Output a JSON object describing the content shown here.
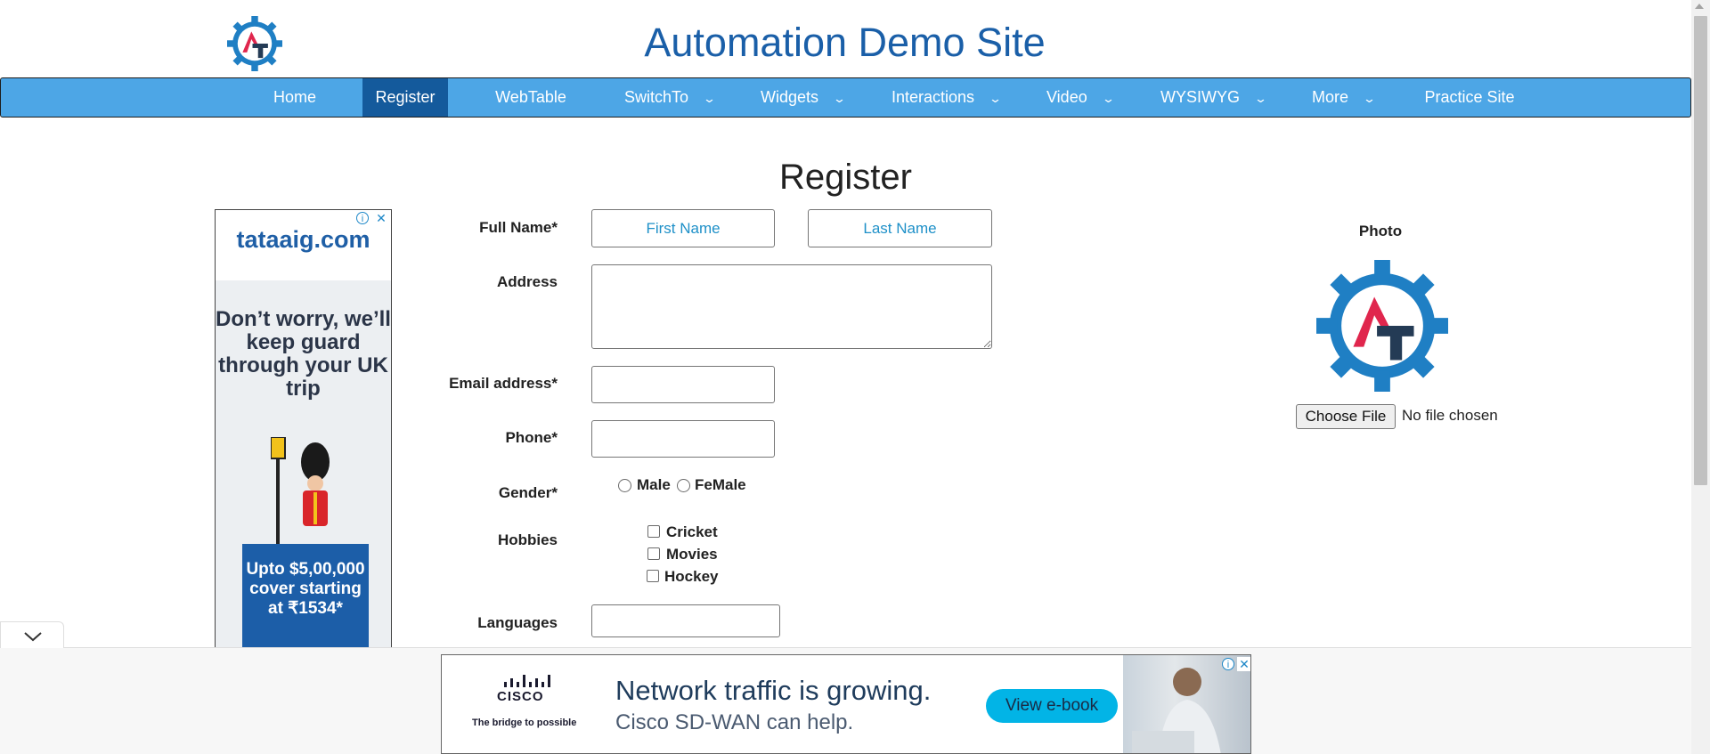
{
  "header": {
    "logo_text": "AT",
    "title": "Automation Demo Site"
  },
  "nav": {
    "items": [
      {
        "label": "Home"
      },
      {
        "label": "Register"
      },
      {
        "label": "WebTable"
      },
      {
        "label": "SwitchTo"
      },
      {
        "label": "Widgets"
      },
      {
        "label": "Interactions"
      },
      {
        "label": "Video"
      },
      {
        "label": "WYSIWYG"
      },
      {
        "label": "More"
      },
      {
        "label": "Practice Site"
      }
    ],
    "active": "Register",
    "chevron": "⌄"
  },
  "form": {
    "title": "Register",
    "full_name_label": "Full Name*",
    "first_name_placeholder": "First Name",
    "last_name_placeholder": "Last Name",
    "address_label": "Address",
    "email_label": "Email address*",
    "phone_label": "Phone*",
    "gender_label": "Gender*",
    "gender_options": [
      "Male",
      "FeMale"
    ],
    "hobbies_label": "Hobbies",
    "hobbies": [
      "Cricket",
      "Movies",
      "Hockey"
    ],
    "languages_label": "Languages"
  },
  "photo": {
    "label": "Photo",
    "button_label": "Choose File",
    "status": "No file chosen"
  },
  "side_ad": {
    "brand": "tataaig.com",
    "headline": "Don’t worry, we’ll keep guard through your UK trip",
    "offer": "Upto $5,00,000 cover starting at ₹1534*"
  },
  "bottom_ad": {
    "brand": "CISCO",
    "tagline": "The bridge to possible",
    "headline": "Network traffic is growing.",
    "subline": "Cisco SD-WAN can help.",
    "cta": "View e-book"
  },
  "colors": {
    "nav_bg": "#4da6e6",
    "nav_active": "#145a9c",
    "title_blue": "#1a5fa8",
    "logo_red": "#e0264d",
    "logo_dark": "#243b55",
    "gear_blue": "#1f7fc4"
  }
}
